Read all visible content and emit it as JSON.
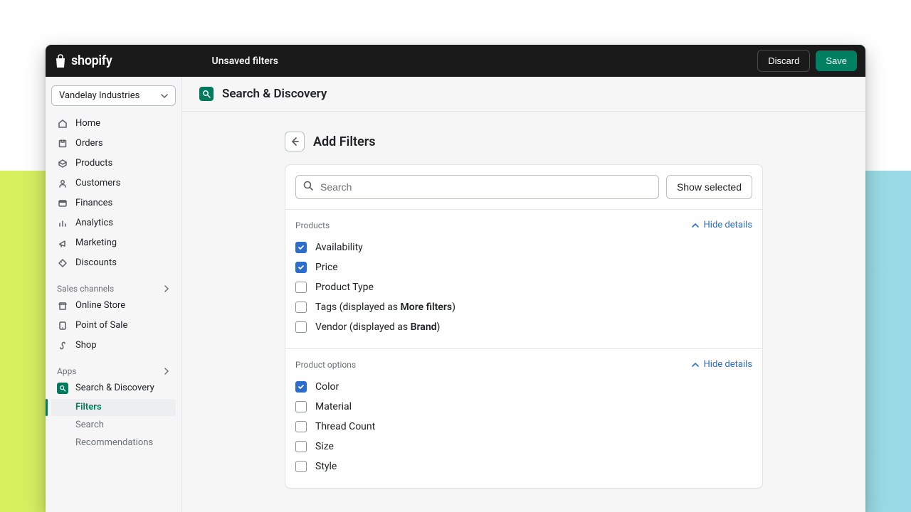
{
  "topbar": {
    "brand": "shopify",
    "status": "Unsaved filters",
    "discard": "Discard",
    "save": "Save"
  },
  "store_selector": {
    "value": "Vandelay Industries"
  },
  "sidebar": {
    "primary": [
      {
        "icon": "home-icon",
        "label": "Home"
      },
      {
        "icon": "orders-icon",
        "label": "Orders"
      },
      {
        "icon": "products-icon",
        "label": "Products"
      },
      {
        "icon": "customers-icon",
        "label": "Customers"
      },
      {
        "icon": "finances-icon",
        "label": "Finances"
      },
      {
        "icon": "analytics-icon",
        "label": "Analytics"
      },
      {
        "icon": "marketing-icon",
        "label": "Marketing"
      },
      {
        "icon": "discounts-icon",
        "label": "Discounts"
      }
    ],
    "channels_header": "Sales channels",
    "channels": [
      {
        "icon": "store-icon",
        "label": "Online Store"
      },
      {
        "icon": "pos-icon",
        "label": "Point of Sale"
      },
      {
        "icon": "shop-icon",
        "label": "Shop"
      }
    ],
    "apps_header": "Apps",
    "apps": [
      {
        "label": "Search & Discovery",
        "subitems": [
          {
            "label": "Filters",
            "active": true
          },
          {
            "label": "Search",
            "active": false
          },
          {
            "label": "Recommendations",
            "active": false
          }
        ]
      }
    ]
  },
  "app_header": {
    "title": "Search & Discovery"
  },
  "page": {
    "title": "Add Filters",
    "search_placeholder": "Search",
    "show_selected": "Show selected",
    "hide_details": "Hide details"
  },
  "filter_groups": [
    {
      "title": "Products",
      "items": [
        {
          "label": "Availability",
          "checked": true
        },
        {
          "label": "Price",
          "checked": true
        },
        {
          "label": "Product Type",
          "checked": false
        },
        {
          "label": "Tags",
          "displayed_prefix": " (displayed as ",
          "displayed_bold": "More filters",
          "displayed_suffix": ")",
          "checked": false
        },
        {
          "label": "Vendor",
          "displayed_prefix": " (displayed as ",
          "displayed_bold": "Brand",
          "displayed_suffix": ")",
          "checked": false
        }
      ]
    },
    {
      "title": "Product options",
      "items": [
        {
          "label": "Color",
          "checked": true
        },
        {
          "label": "Material",
          "checked": false
        },
        {
          "label": "Thread Count",
          "checked": false
        },
        {
          "label": "Size",
          "checked": false
        },
        {
          "label": "Style",
          "checked": false
        }
      ]
    }
  ]
}
